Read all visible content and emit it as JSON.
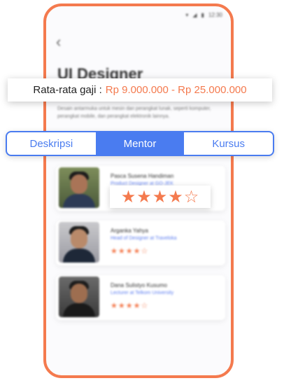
{
  "status": {
    "time": "12:30"
  },
  "page": {
    "title": "UI Designer",
    "description": "Desain antarmuka untuk mesin dan perangkat lunak, seperti komputer, perangkat mobile, dan perangkat elektronik lainnya."
  },
  "salary": {
    "label": "Rata-rata gaji :",
    "value": "Rp 9.000.000 - Rp 25.000.000"
  },
  "tabs": [
    {
      "label": "Deskripsi",
      "active": false
    },
    {
      "label": "Mentor",
      "active": true
    },
    {
      "label": "Kursus",
      "active": false
    }
  ],
  "mentors": [
    {
      "name": "Pasca Susena Handiman",
      "role": "Product Designer at GO-JEK",
      "rating": 4.5
    },
    {
      "name": "Arganka Yahya",
      "role": "Head of Designer at Traveloka",
      "rating": 4.5
    },
    {
      "name": "Dana Sulistyo Kusumo",
      "role": "Lecturer at Telkom University",
      "rating": 4.5
    }
  ],
  "colors": {
    "accent": "#f47a4e",
    "primary": "#4a7cf0"
  }
}
